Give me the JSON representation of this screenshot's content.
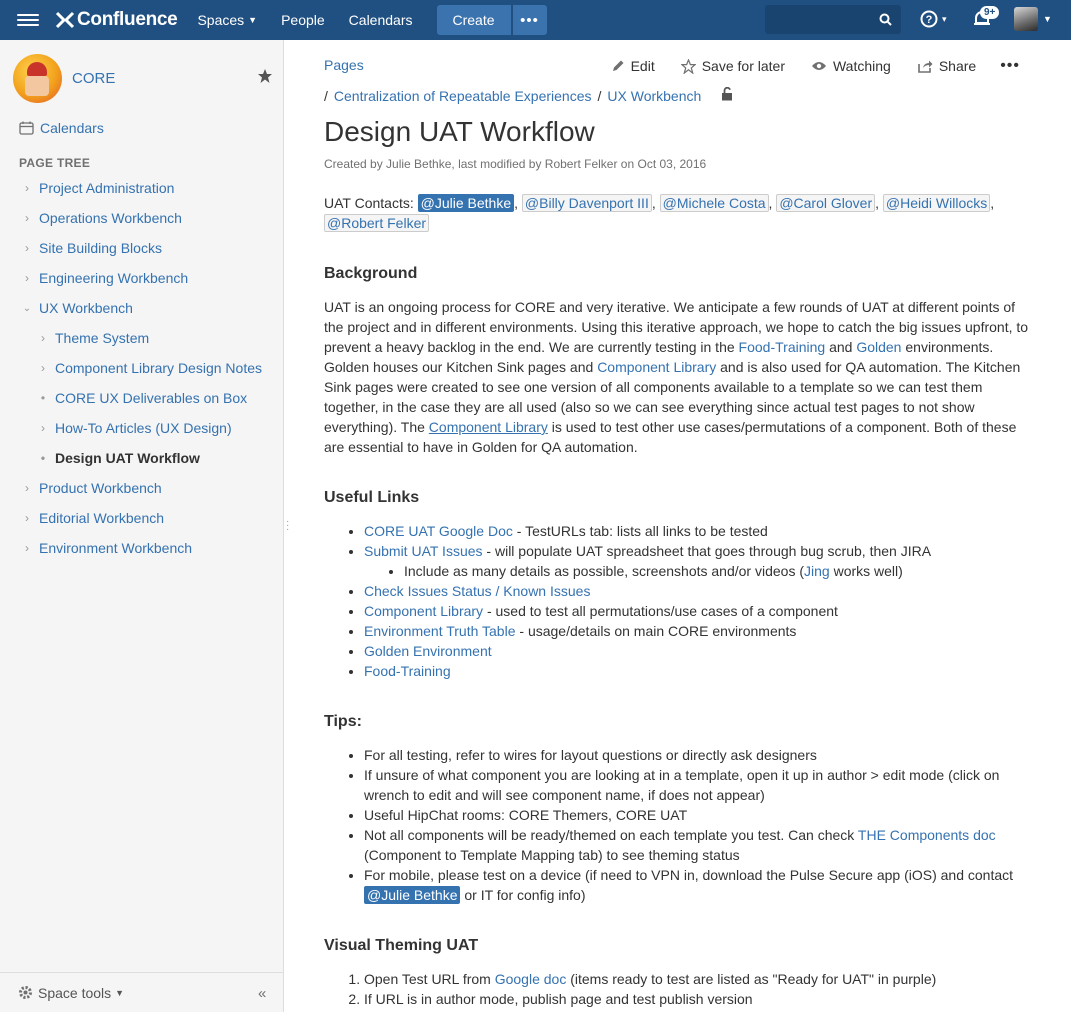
{
  "topbar": {
    "logo": "Confluence",
    "nav": {
      "spaces": "Spaces",
      "people": "People",
      "calendars": "Calendars"
    },
    "create": "Create",
    "more": "•••",
    "help_caret": "▾",
    "notif_badge": "9+"
  },
  "sidebar": {
    "space_name": "CORE",
    "calendars": "Calendars",
    "tree_title": "PAGE TREE",
    "tree": [
      {
        "label": "Project Administration"
      },
      {
        "label": "Operations Workbench"
      },
      {
        "label": "Site Building Blocks"
      },
      {
        "label": "Engineering Workbench"
      },
      {
        "label": "UX Workbench"
      },
      {
        "label": "Theme System"
      },
      {
        "label": "Component Library Design Notes"
      },
      {
        "label": "CORE UX Deliverables on Box"
      },
      {
        "label": "How-To Articles (UX Design)"
      },
      {
        "label": "Design UAT Workflow"
      },
      {
        "label": "Product Workbench"
      },
      {
        "label": "Editorial Workbench"
      },
      {
        "label": "Environment Workbench"
      }
    ],
    "space_tools": "Space tools",
    "collapse": "«"
  },
  "page": {
    "pages_link": "Pages",
    "actions": {
      "edit": "Edit",
      "save": "Save for later",
      "watching": "Watching",
      "share": "Share",
      "more": "•••"
    },
    "breadcrumbs": [
      "Centralization of Repeatable Experiences",
      "UX Workbench"
    ],
    "title": "Design UAT Workflow",
    "byline": "Created by Julie Bethke, last modified by Robert Felker on Oct 03, 2016"
  },
  "content": {
    "contacts_label": "UAT Contacts:",
    "contacts": [
      "@Julie Bethke",
      "@Billy Davenport III",
      "@Michele Costa",
      "@Carol Glover",
      "@Heidi Willocks",
      "@Robert Felker"
    ],
    "background": {
      "heading": "Background",
      "t1": "UAT is an ongoing process for CORE and very iterative. We anticipate a few rounds of UAT at different points of the project and in different environments. Using this iterative approach, we hope to catch the big issues upfront, to prevent a heavy backlog in the end. We are currently testing in the ",
      "l1": "Food-Training",
      "t2": " and ",
      "l2": "Golden",
      "t3": " environments. Golden houses our Kitchen Sink pages and ",
      "l3": "Component Library",
      "t4": " and is also used for QA automation. The Kitchen Sink pages were created to see one version of all components available to a template so we can test them together, in the case they are all used (also so we can see everything since actual test pages to not show everything). The ",
      "l4": "Component Library",
      "t5": " is used to test other use cases/permutations of a component. Both of these are essential to have in Golden for QA automation."
    },
    "useful": {
      "heading": "Useful Links",
      "i1_link": "CORE UAT Google Doc",
      "i1_text": " - TestURLs tab: lists all links to be tested",
      "i2_link": "Submit UAT Issues",
      "i2_text": " - will populate UAT spreadsheet that goes through bug scrub, then JIRA",
      "i2_sub_text": "Include as many details as possible, screenshots and/or videos (",
      "i2_sub_link": "Jing",
      "i2_sub_end": " works well)",
      "i3_link": "Check Issues Status / Known Issues",
      "i4_link": "Component Library",
      "i4_text": " - used to test all permutations/use cases of a component",
      "i5_link": "Environment Truth Table",
      "i5_text": " - usage/details on main CORE environments",
      "i6_link": "Golden Environment",
      "i7_link": "Food-Training"
    },
    "tips": {
      "heading": "Tips:",
      "t1": "For all testing, refer to wires for layout questions or directly ask designers",
      "t2": "If unsure of what component you are looking at in a template, open it up in author > edit mode (click on wrench to edit and will see component name, if does not appear)",
      "t3": "Useful HipChat rooms: CORE Themers, CORE UAT",
      "t4a": "Not all components will be ready/themed on each template you test. Can check ",
      "t4_link": "THE Components doc",
      "t4b": " (Component to Template Mapping tab) to see theming status",
      "t5a": "For mobile, please test on a device (if need to VPN in, download the Pulse Secure app (iOS) and contact ",
      "t5_mention": "@Julie Bethke",
      "t5b": " or IT for config info)"
    },
    "visual": {
      "heading": "Visual Theming UAT",
      "s1a": "Open Test URL from ",
      "s1_link": "Google doc",
      "s1b": " (items ready to test are listed as \"Ready for UAT\" in purple)",
      "s2": "If URL is in author mode, publish page and test publish version"
    }
  }
}
